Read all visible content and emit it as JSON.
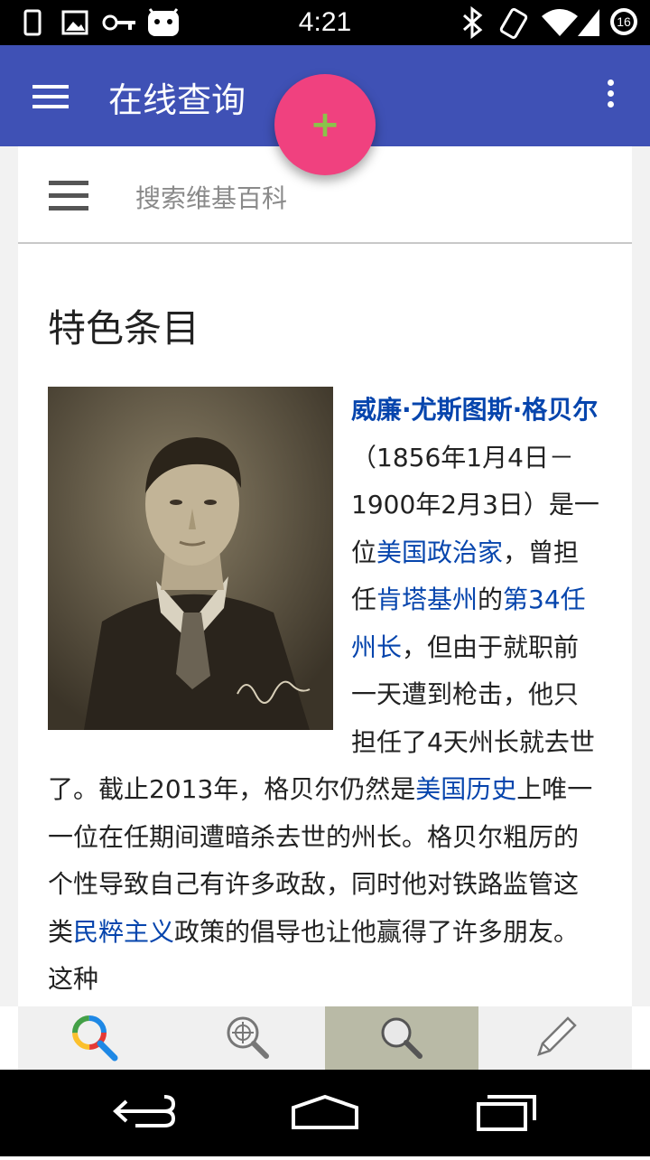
{
  "status_bar": {
    "time": "4:21",
    "battery_level": "16",
    "left_icons": [
      "sim-icon",
      "image-icon",
      "key-icon",
      "android-icon"
    ],
    "right_icons": [
      "bluetooth-icon",
      "vibrate-icon",
      "wifi-icon",
      "signal-icon",
      "battery-icon"
    ]
  },
  "app_bar": {
    "title": "在线查询",
    "menu_icon": "hamburger-menu-icon",
    "overflow_icon": "more-vert-icon",
    "color": "#3f51b5"
  },
  "fab": {
    "label": "+",
    "icon": "add-icon",
    "color": "#f0417f"
  },
  "search": {
    "placeholder": "搜索维基百科"
  },
  "section": {
    "title": "特色条目"
  },
  "article": {
    "image_alt": "portrait-photo",
    "segments": [
      {
        "text": "威廉·尤斯图斯·格贝尔",
        "link": true,
        "bold": true
      },
      {
        "text": "（1856年1月4日－1900年2月3日）是一位",
        "link": false
      },
      {
        "text": "美国政治家",
        "link": true
      },
      {
        "text": "，曾担任",
        "link": false
      },
      {
        "text": "肯塔基州",
        "link": true
      },
      {
        "text": "的",
        "link": false
      },
      {
        "text": "第34任州长",
        "link": true
      },
      {
        "text": "，但由于就职前一天遭到枪击，他只担任了4天州长就去世了。截止2013年，格贝尔仍然是",
        "link": false
      },
      {
        "text": "美国历史",
        "link": true
      },
      {
        "text": "上唯一一位在任期间遭暗杀去世的州长。格贝尔粗厉的个性导致自己有许多政敌，同时他对铁路监管这类",
        "link": false
      },
      {
        "text": "民粹主义",
        "link": true
      },
      {
        "text": "政策的倡导也让他赢得了许多朋友。这种",
        "link": false
      }
    ]
  },
  "bottom_tabs": [
    {
      "icon": "color-search-icon",
      "active": false
    },
    {
      "icon": "globe-search-icon",
      "active": false
    },
    {
      "icon": "search-icon",
      "active": true
    },
    {
      "icon": "pencil-icon",
      "active": false
    }
  ],
  "nav_bar": {
    "icons": [
      "back-icon",
      "home-icon",
      "recents-icon"
    ]
  }
}
